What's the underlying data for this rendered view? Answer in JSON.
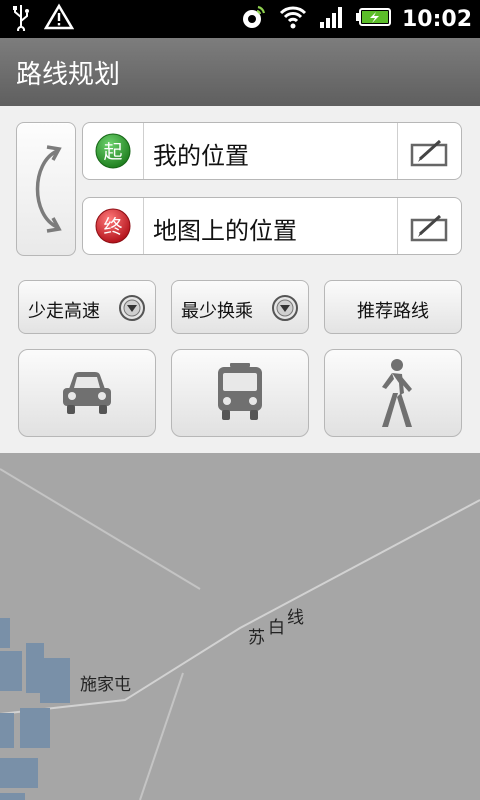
{
  "status_bar": {
    "time": "10:02",
    "icons": [
      "usb-icon",
      "warning-icon",
      "gps-icon",
      "wifi-icon",
      "signal-icon",
      "battery-charging-icon"
    ]
  },
  "app": {
    "title": "路线规划"
  },
  "route": {
    "start": {
      "badge": "起",
      "text": "我的位置",
      "badge_color": "#2e9a2e"
    },
    "end": {
      "badge": "终",
      "text": "地图上的位置",
      "badge_color": "#d0202a"
    }
  },
  "options": {
    "driving_pref": "少走高速",
    "transit_pref": "最少换乘",
    "walking_pref": "推荐路线"
  },
  "modes": [
    "car-icon",
    "bus-icon",
    "walk-icon"
  ],
  "map": {
    "labels": {
      "road": "苏白线",
      "village": "施家屯"
    },
    "road_chars": [
      "苏",
      "白",
      "线"
    ]
  }
}
